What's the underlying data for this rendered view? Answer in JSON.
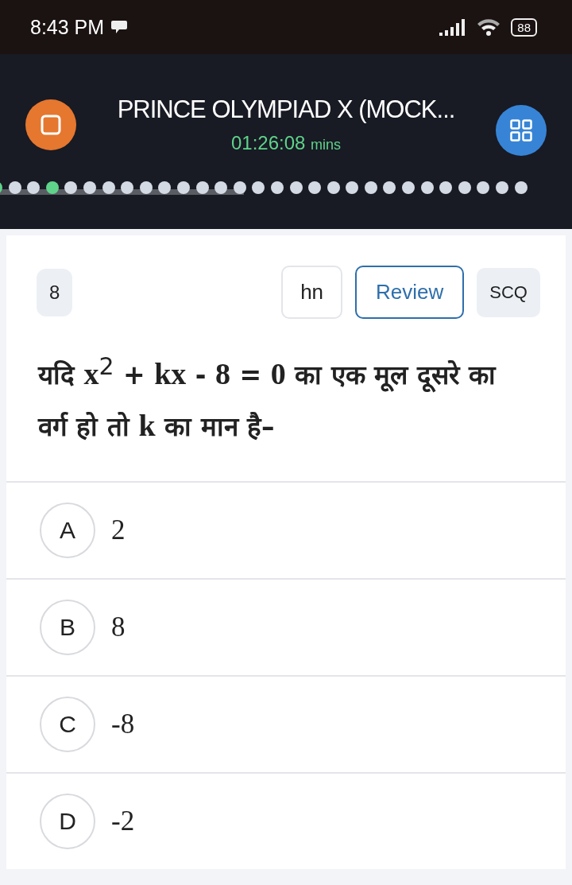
{
  "status_bar": {
    "time": "8:43 PM",
    "battery": "88"
  },
  "header": {
    "title": "PRINCE OLYMPIAD X (MOCK...",
    "timer": "01:26:08",
    "timer_unit": "mins"
  },
  "question_dots": [
    {
      "answered": true
    },
    {
      "answered": false
    },
    {
      "answered": false
    },
    {
      "answered": true
    },
    {
      "answered": false
    },
    {
      "answered": false
    },
    {
      "answered": false
    },
    {
      "answered": false
    },
    {
      "answered": false
    },
    {
      "answered": false
    },
    {
      "answered": false
    },
    {
      "answered": false
    },
    {
      "answered": false
    },
    {
      "answered": false
    },
    {
      "answered": false
    },
    {
      "answered": false
    },
    {
      "answered": false
    },
    {
      "answered": false
    },
    {
      "answered": false
    },
    {
      "answered": false
    },
    {
      "answered": false
    },
    {
      "answered": false
    },
    {
      "answered": false
    },
    {
      "answered": false
    },
    {
      "answered": false
    },
    {
      "answered": false
    },
    {
      "answered": false
    },
    {
      "answered": false
    },
    {
      "answered": false
    }
  ],
  "question": {
    "number": "8",
    "language": "hn",
    "review": "Review",
    "type": "SCQ",
    "text": "यदि **x**$^{2}$ + **kx** - **8** = **0** का एक मूल दूसरे का वर्ग हो तो **k** का मान है–"
  },
  "options": [
    {
      "label": "A",
      "value": "2",
      "selected": false
    },
    {
      "label": "B",
      "value": "8",
      "selected": false
    },
    {
      "label": "C",
      "value": "-8",
      "selected": false
    },
    {
      "label": "D",
      "value": "-2",
      "selected": false
    }
  ]
}
